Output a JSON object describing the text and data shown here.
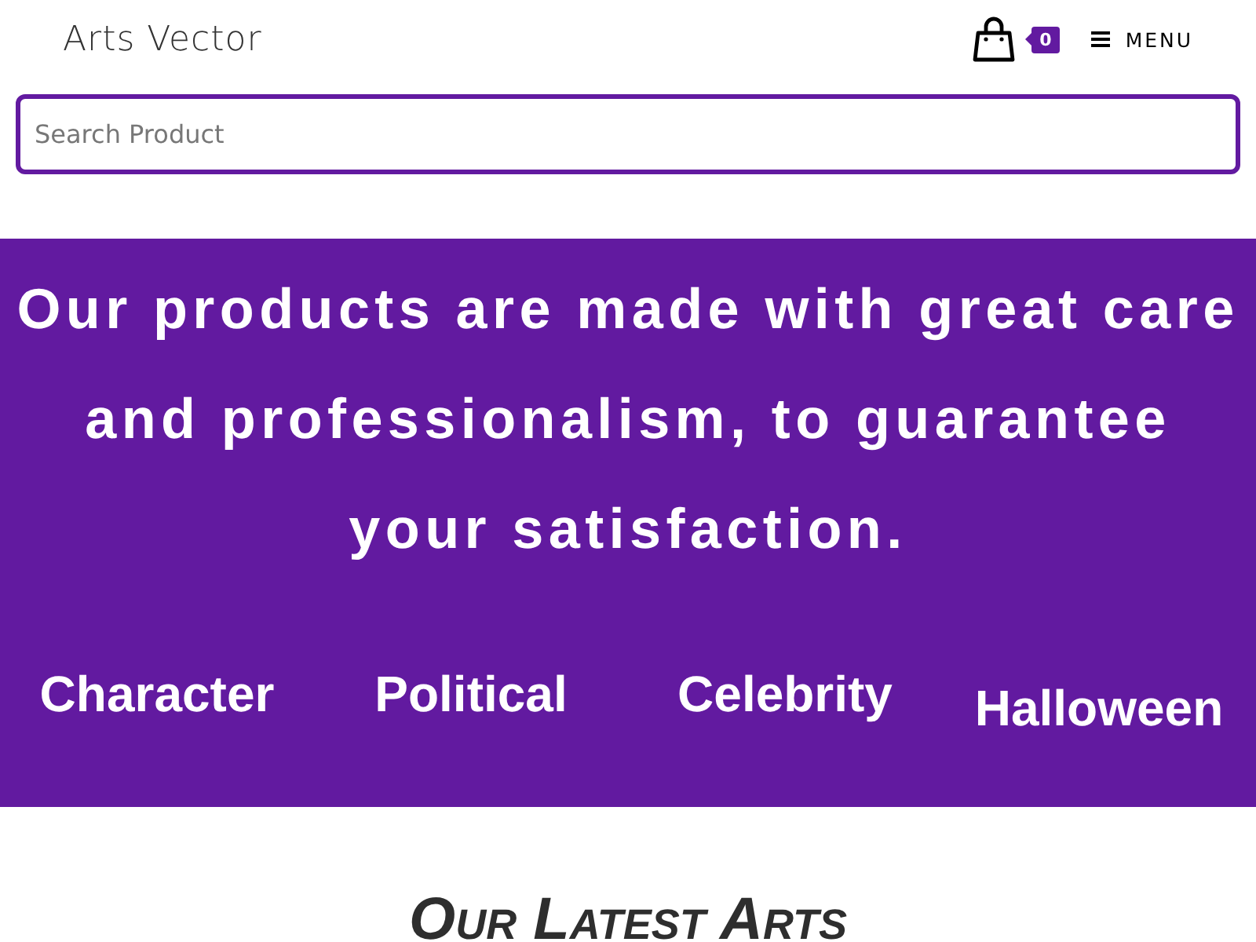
{
  "header": {
    "logo": "Arts Vector",
    "cart": {
      "count": "0"
    },
    "menu": {
      "label": "MENU"
    }
  },
  "search": {
    "placeholder": "Search Product"
  },
  "hero": {
    "heading": "Our products are made with great care and professionalism, to guarantee your satisfaction.",
    "categories": [
      "Character",
      "Political",
      "Celebrity",
      "Halloween"
    ]
  },
  "latest": {
    "title": "Our Latest Arts"
  }
}
